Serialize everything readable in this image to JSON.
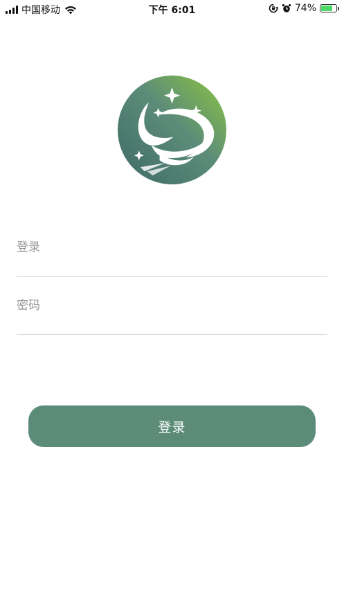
{
  "status_bar": {
    "carrier": "中国移动",
    "time": "下午 6:01",
    "battery_percent": "74%",
    "battery_level": 0.74,
    "icons": [
      "signal-bars-icon",
      "wifi-icon",
      "orientation-lock-icon",
      "alarm-icon",
      "battery-charging-icon"
    ]
  },
  "logo": {
    "icon": "brand-logo-icon",
    "colors": {
      "green": "#8cc63f",
      "teal": "#5c8c79",
      "dark": "#3e6a66"
    }
  },
  "form": {
    "username_placeholder": "登录",
    "password_placeholder": "密码"
  },
  "login_button": {
    "label": "登录",
    "color": "#5c8c79"
  }
}
